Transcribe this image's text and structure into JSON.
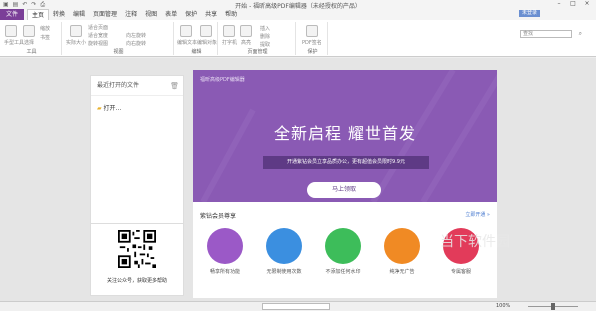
{
  "window": {
    "title": "开始 - 福昕高级PDF编辑器（未经授权的产品）"
  },
  "quick_access": [
    "save",
    "undo",
    "redo",
    "print"
  ],
  "menu": {
    "file_label": "文件",
    "tabs": [
      "主页",
      "转换",
      "编辑",
      "页面管理",
      "注释",
      "视图",
      "表单",
      "保护",
      "共享",
      "帮助"
    ],
    "active_tab": "主页",
    "promo_label": "未登录"
  },
  "ribbon": {
    "search_placeholder": "查找",
    "groups": [
      {
        "name": "工具",
        "items": [
          "手型工具",
          "选择",
          "缩放",
          "书签"
        ]
      },
      {
        "name": "视图",
        "items": [
          "实际大小",
          "适合页面",
          "适合宽度",
          "旋转视图",
          "向左旋转",
          "向右旋转"
        ]
      },
      {
        "name": "编辑",
        "items": [
          "编辑文本",
          "编辑对象"
        ]
      },
      {
        "name": "页面管理",
        "items": [
          "打字机",
          "高亮",
          "插入",
          "删除",
          "提取"
        ]
      },
      {
        "name": "保护",
        "items": [
          "PDF签名"
        ]
      }
    ]
  },
  "recent_panel": {
    "title": "最近打开的文件",
    "open_label": "打开..."
  },
  "qr_card": {
    "text": "关注公众号，获取更多帮助"
  },
  "banner": {
    "brand": "福昕高级PDF编辑器",
    "headline": "全新启程 耀世首发",
    "strip": "开通紫钻会员立享品质办公，更有超值会员限时9.9元",
    "button": "马上领取"
  },
  "members": {
    "title": "紫钻会员尊享",
    "link": "立即开通 »",
    "items": [
      {
        "label": "畅享所有功能",
        "color": "#9b59c7"
      },
      {
        "label": "无限制使用次数",
        "color": "#3b8fe0"
      },
      {
        "label": "不添加任何水印",
        "color": "#3dbd5a"
      },
      {
        "label": "纯净无广告",
        "color": "#f08a24"
      },
      {
        "label": "专属客服",
        "color": "#e23b5a"
      }
    ]
  },
  "statusbar": {
    "zoom": "100%"
  },
  "watermark": {
    "text": "当下软件园"
  }
}
